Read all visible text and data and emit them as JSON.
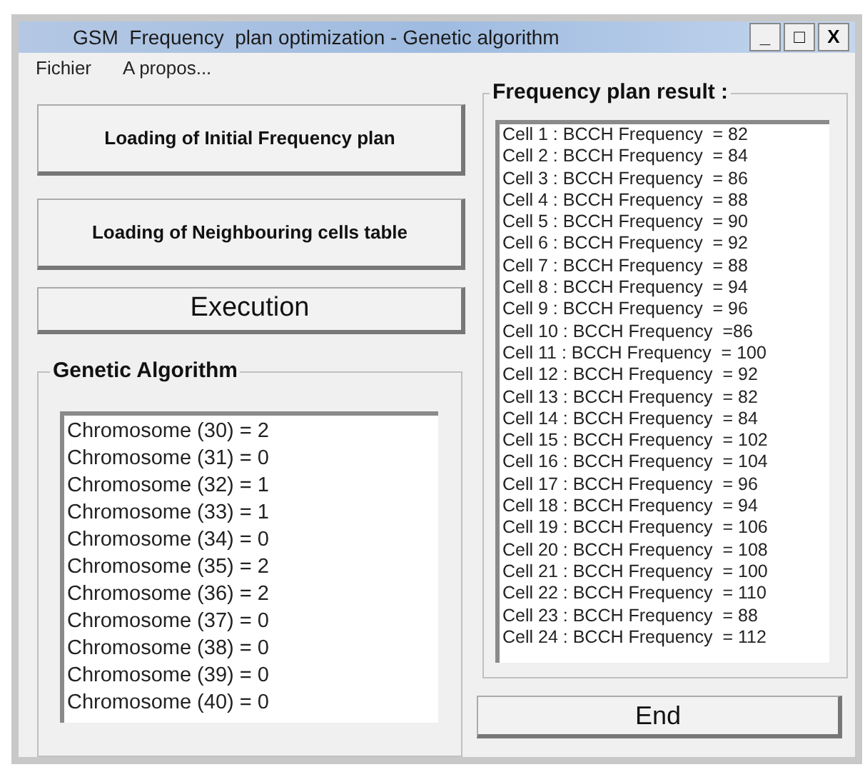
{
  "window": {
    "title": "GSM  Frequency  plan optimization - Genetic algorithm"
  },
  "title_buttons": [
    "_",
    "□",
    "X"
  ],
  "menu": [
    "Fichier",
    "A propos..."
  ],
  "buttons": [
    {
      "label": "Loading of  Initial Frequency plan",
      "kind": "small"
    },
    {
      "label": "Loading of  Neighbouring cells table",
      "kind": "small"
    },
    {
      "label": "Execution",
      "kind": "large"
    }
  ],
  "genetic_algorithm": {
    "title": "Genetic Algorithm",
    "items": [
      "Chromosome (30) = 2",
      "Chromosome (31) = 0",
      "Chromosome (32) = 1",
      "Chromosome (33) = 1",
      "Chromosome (34) = 0",
      "Chromosome (35) = 2",
      "Chromosome (36) = 2",
      "Chromosome (37) = 0",
      "Chromosome (38) = 0",
      "Chromosome (39) = 0",
      "Chromosome (40) = 0"
    ]
  },
  "frequency_plan": {
    "title": "Frequency plan result :",
    "items": [
      "Cell 1 : BCCH Frequency  = 82",
      "Cell 2 : BCCH Frequency  = 84",
      "Cell 3 : BCCH Frequency  = 86",
      "Cell 4 : BCCH Frequency  = 88",
      "Cell 5 : BCCH Frequency  = 90",
      "Cell 6 : BCCH Frequency  = 92",
      "Cell 7 : BCCH Frequency  = 88",
      "Cell 8 : BCCH Frequency  = 94",
      "Cell 9 : BCCH Frequency  = 96",
      "Cell 10 : BCCH Frequency  =86",
      "Cell 11 : BCCH Frequency  = 100",
      "Cell 12 : BCCH Frequency  = 92",
      "Cell 13 : BCCH Frequency  = 82",
      "Cell 14 : BCCH Frequency  = 84",
      "Cell 15 : BCCH Frequency  = 102",
      "Cell 16 : BCCH Frequency  = 104",
      "Cell 17 : BCCH Frequency  = 96",
      "Cell 18 : BCCH Frequency  = 94",
      "Cell 19 : BCCH Frequency  = 106",
      "Cell 20 : BCCH Frequency  = 108",
      "Cell 21 : BCCH Frequency  = 100",
      "Cell 22 : BCCH Frequency  = 110",
      "Cell 23 : BCCH Frequency  = 88",
      "Cell 24 : BCCH Frequency  = 112"
    ]
  },
  "end_button": "End"
}
